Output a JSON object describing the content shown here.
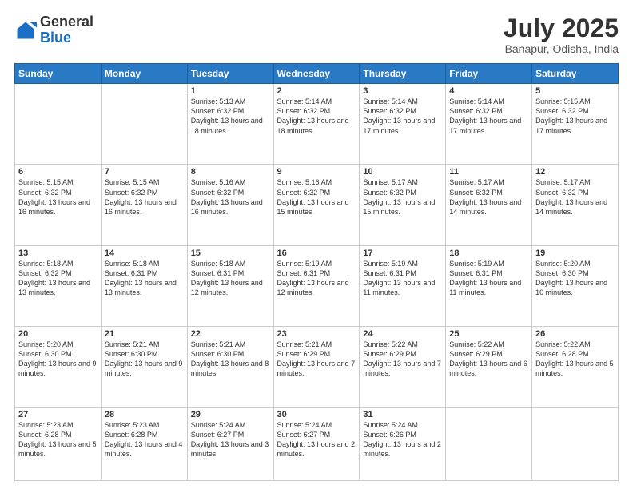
{
  "header": {
    "logo_general": "General",
    "logo_blue": "Blue",
    "title": "July 2025",
    "location": "Banapur, Odisha, India"
  },
  "days_of_week": [
    "Sunday",
    "Monday",
    "Tuesday",
    "Wednesday",
    "Thursday",
    "Friday",
    "Saturday"
  ],
  "weeks": [
    [
      {
        "day": "",
        "info": ""
      },
      {
        "day": "",
        "info": ""
      },
      {
        "day": "1",
        "info": "Sunrise: 5:13 AM\nSunset: 6:32 PM\nDaylight: 13 hours and 18 minutes."
      },
      {
        "day": "2",
        "info": "Sunrise: 5:14 AM\nSunset: 6:32 PM\nDaylight: 13 hours and 18 minutes."
      },
      {
        "day": "3",
        "info": "Sunrise: 5:14 AM\nSunset: 6:32 PM\nDaylight: 13 hours and 17 minutes."
      },
      {
        "day": "4",
        "info": "Sunrise: 5:14 AM\nSunset: 6:32 PM\nDaylight: 13 hours and 17 minutes."
      },
      {
        "day": "5",
        "info": "Sunrise: 5:15 AM\nSunset: 6:32 PM\nDaylight: 13 hours and 17 minutes."
      }
    ],
    [
      {
        "day": "6",
        "info": "Sunrise: 5:15 AM\nSunset: 6:32 PM\nDaylight: 13 hours and 16 minutes."
      },
      {
        "day": "7",
        "info": "Sunrise: 5:15 AM\nSunset: 6:32 PM\nDaylight: 13 hours and 16 minutes."
      },
      {
        "day": "8",
        "info": "Sunrise: 5:16 AM\nSunset: 6:32 PM\nDaylight: 13 hours and 16 minutes."
      },
      {
        "day": "9",
        "info": "Sunrise: 5:16 AM\nSunset: 6:32 PM\nDaylight: 13 hours and 15 minutes."
      },
      {
        "day": "10",
        "info": "Sunrise: 5:17 AM\nSunset: 6:32 PM\nDaylight: 13 hours and 15 minutes."
      },
      {
        "day": "11",
        "info": "Sunrise: 5:17 AM\nSunset: 6:32 PM\nDaylight: 13 hours and 14 minutes."
      },
      {
        "day": "12",
        "info": "Sunrise: 5:17 AM\nSunset: 6:32 PM\nDaylight: 13 hours and 14 minutes."
      }
    ],
    [
      {
        "day": "13",
        "info": "Sunrise: 5:18 AM\nSunset: 6:32 PM\nDaylight: 13 hours and 13 minutes."
      },
      {
        "day": "14",
        "info": "Sunrise: 5:18 AM\nSunset: 6:31 PM\nDaylight: 13 hours and 13 minutes."
      },
      {
        "day": "15",
        "info": "Sunrise: 5:18 AM\nSunset: 6:31 PM\nDaylight: 13 hours and 12 minutes."
      },
      {
        "day": "16",
        "info": "Sunrise: 5:19 AM\nSunset: 6:31 PM\nDaylight: 13 hours and 12 minutes."
      },
      {
        "day": "17",
        "info": "Sunrise: 5:19 AM\nSunset: 6:31 PM\nDaylight: 13 hours and 11 minutes."
      },
      {
        "day": "18",
        "info": "Sunrise: 5:19 AM\nSunset: 6:31 PM\nDaylight: 13 hours and 11 minutes."
      },
      {
        "day": "19",
        "info": "Sunrise: 5:20 AM\nSunset: 6:30 PM\nDaylight: 13 hours and 10 minutes."
      }
    ],
    [
      {
        "day": "20",
        "info": "Sunrise: 5:20 AM\nSunset: 6:30 PM\nDaylight: 13 hours and 9 minutes."
      },
      {
        "day": "21",
        "info": "Sunrise: 5:21 AM\nSunset: 6:30 PM\nDaylight: 13 hours and 9 minutes."
      },
      {
        "day": "22",
        "info": "Sunrise: 5:21 AM\nSunset: 6:30 PM\nDaylight: 13 hours and 8 minutes."
      },
      {
        "day": "23",
        "info": "Sunrise: 5:21 AM\nSunset: 6:29 PM\nDaylight: 13 hours and 7 minutes."
      },
      {
        "day": "24",
        "info": "Sunrise: 5:22 AM\nSunset: 6:29 PM\nDaylight: 13 hours and 7 minutes."
      },
      {
        "day": "25",
        "info": "Sunrise: 5:22 AM\nSunset: 6:29 PM\nDaylight: 13 hours and 6 minutes."
      },
      {
        "day": "26",
        "info": "Sunrise: 5:22 AM\nSunset: 6:28 PM\nDaylight: 13 hours and 5 minutes."
      }
    ],
    [
      {
        "day": "27",
        "info": "Sunrise: 5:23 AM\nSunset: 6:28 PM\nDaylight: 13 hours and 5 minutes."
      },
      {
        "day": "28",
        "info": "Sunrise: 5:23 AM\nSunset: 6:28 PM\nDaylight: 13 hours and 4 minutes."
      },
      {
        "day": "29",
        "info": "Sunrise: 5:24 AM\nSunset: 6:27 PM\nDaylight: 13 hours and 3 minutes."
      },
      {
        "day": "30",
        "info": "Sunrise: 5:24 AM\nSunset: 6:27 PM\nDaylight: 13 hours and 2 minutes."
      },
      {
        "day": "31",
        "info": "Sunrise: 5:24 AM\nSunset: 6:26 PM\nDaylight: 13 hours and 2 minutes."
      },
      {
        "day": "",
        "info": ""
      },
      {
        "day": "",
        "info": ""
      }
    ]
  ]
}
